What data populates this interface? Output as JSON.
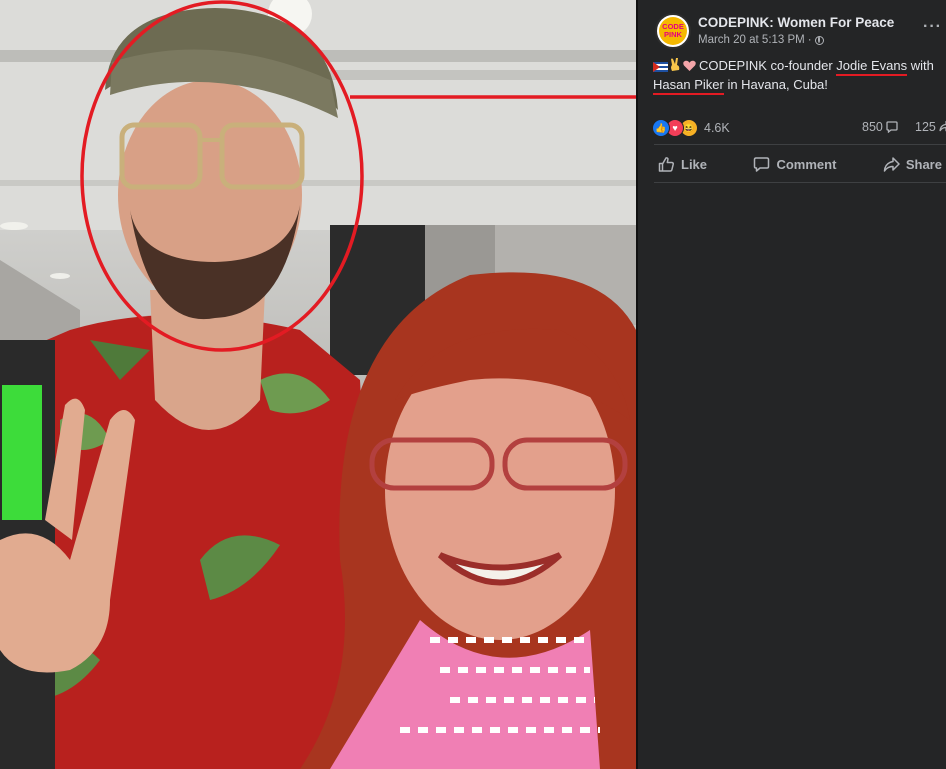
{
  "post": {
    "page_name": "CODEPINK: Women For Peace",
    "avatar_text_1": "CODE",
    "avatar_text_2": "PINK",
    "timestamp": "March 20 at 5:13 PM",
    "separator": "·",
    "text_before": "CODEPINK co-founder",
    "tagged_1": "Jodie Evans",
    "text_middle": "with",
    "tagged_2": "Hasan Piker",
    "text_after": "in Havana, Cuba!",
    "emojis": [
      "cuba-flag-icon",
      "victory-hand-icon",
      "heart-icon"
    ]
  },
  "stats": {
    "reactions_count": "4.6K",
    "reaction_types": [
      "like-icon",
      "love-icon",
      "haha-icon"
    ],
    "comments_count": "850",
    "shares_count": "125"
  },
  "actions": {
    "like": "Like",
    "comment": "Comment",
    "share": "Share"
  },
  "colors": {
    "panel_bg": "#242526",
    "text": "#e4e6eb",
    "muted": "#b0b3b8",
    "annotation_red": "#e31b23",
    "like_blue": "#1877f2",
    "love_red": "#f33e58",
    "haha_yellow": "#f7b125"
  }
}
